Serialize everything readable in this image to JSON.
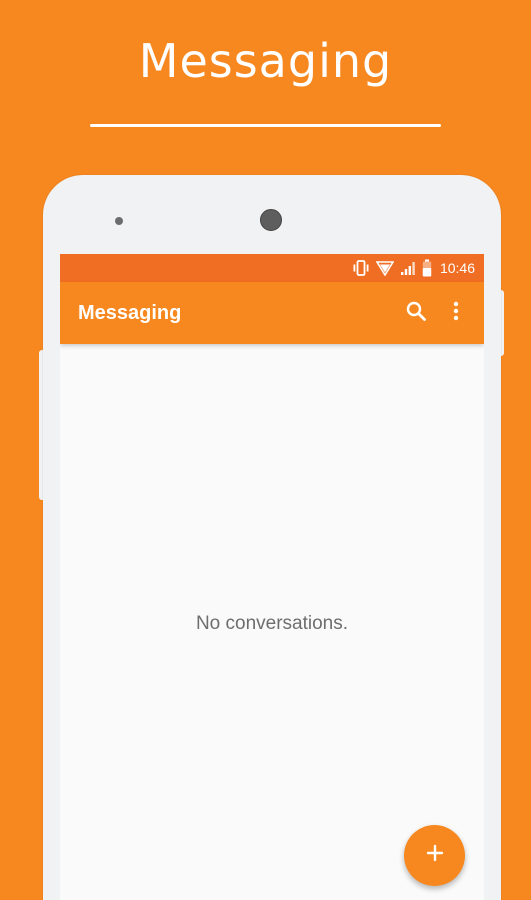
{
  "promo": {
    "title": "Messaging"
  },
  "status_bar": {
    "time": "10:46",
    "icons": [
      "vibrate-icon",
      "wifi-icon",
      "signal-icon",
      "battery-icon"
    ]
  },
  "app_bar": {
    "title": "Messaging",
    "actions": [
      "search-icon",
      "more-vert-icon"
    ]
  },
  "main": {
    "empty_message": "No conversations."
  },
  "fab": {
    "icon": "plus-icon"
  },
  "colors": {
    "background": "#F78820",
    "status_bar": "#F06E23",
    "app_bar": "#F7881F",
    "fab": "#F7881F",
    "screen": "#FAFAFA",
    "device": "#F1F2F3"
  }
}
